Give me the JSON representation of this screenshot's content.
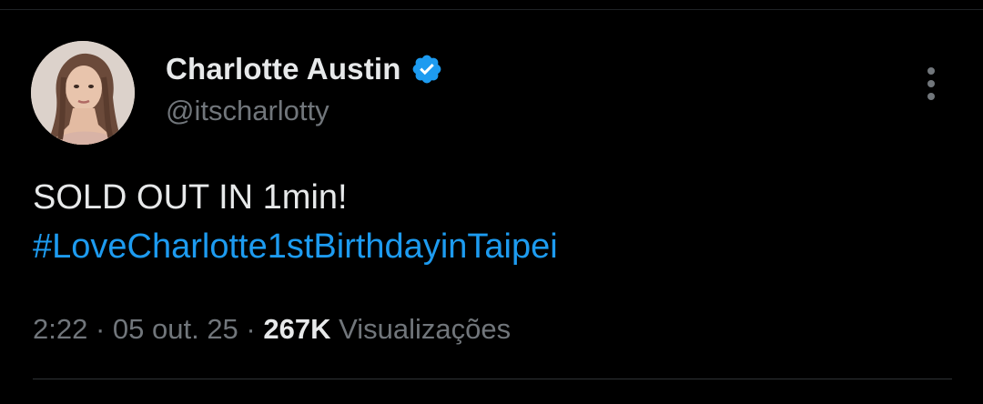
{
  "author": {
    "display_name": "Charlotte Austin",
    "handle": "@itscharlotty",
    "verified": true,
    "avatar_icon": "profile-photo"
  },
  "tweet": {
    "line1": "SOLD OUT IN 1min!",
    "hashtag": "#LoveCharlotte1stBirthdayinTaipei"
  },
  "meta": {
    "time": "2:22",
    "separator": " · ",
    "date": "05 out. 25",
    "views_count": "267K",
    "views_label": "Visualizações"
  },
  "menu": {
    "more_icon": "more-vertical-icon"
  },
  "colors": {
    "background": "#000000",
    "text_primary": "#e7e9ea",
    "text_secondary": "#71767b",
    "accent": "#1d9bf0",
    "divider": "#2f3336"
  }
}
